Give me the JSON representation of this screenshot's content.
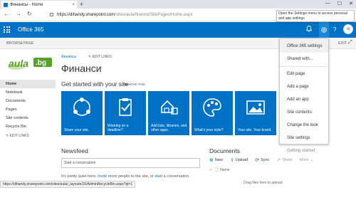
{
  "browser": {
    "tab_title": "Финансы - Home",
    "tab_close": "×",
    "new_tab": "+",
    "minimize": "—",
    "maximize": "☐",
    "close": "✕",
    "back": "←",
    "forward": "→",
    "refresh": "↻",
    "url_host": "https://dihandy.sharepoint.com",
    "url_path": "/sites/aula/finance/SitePages/Home.aspx",
    "tooltip": "Open the Settings menu to access personal and app settings"
  },
  "suitebar": {
    "brand": "Office 365",
    "bell_icon": "bell-icon",
    "gear_icon": "gear-icon",
    "help": "?",
    "color": "#0072c6"
  },
  "ribbon": {
    "browse": "BROWSE",
    "page": "PAGE",
    "edit": "EDIT"
  },
  "logo": {
    "text": "aula.bg"
  },
  "leftnav": {
    "items": [
      "Home",
      "Notebook",
      "Documents",
      "Pages",
      "Site contents",
      "Recycle Bin"
    ],
    "edit_links": "EDIT LINKS"
  },
  "header": {
    "breadcrumb": "Финансы",
    "edit_links": "EDIT LINKS",
    "title": "Финанси"
  },
  "getting_started": {
    "title": "Get started with your site",
    "remove": "REMOVE THIS",
    "tiles": [
      {
        "label": "Share your site.",
        "icon": "share-icon"
      },
      {
        "label": "Working on a deadline?",
        "icon": "checklist-icon"
      },
      {
        "label": "Add lists, libraries, and other apps.",
        "icon": "apps-icon"
      },
      {
        "label": "What's your style?",
        "icon": "palette-icon"
      },
      {
        "label": "Your site. Your brand.",
        "icon": "image-icon"
      }
    ]
  },
  "newsfeed": {
    "title": "Newsfeed",
    "placeholder": "Start a conversation",
    "note_prefix": "It's pretty quiet here. ",
    "note_invite": "Invite",
    "note_middle": " more people to the site, or ",
    "note_start": "start",
    "note_suffix": " a conversation."
  },
  "documents": {
    "title": "Documents",
    "new": "New",
    "upload": "Upload",
    "sync": "Sync",
    "share": "Share",
    "more": "More",
    "column_name": "Name",
    "drag_hint": "Drag files here to upload"
  },
  "settings_menu": {
    "items": [
      "Office 365 settings",
      "Shared with...",
      "Edit page",
      "Add a page",
      "Add an app",
      "Site contents",
      "Change the look",
      "Site settings",
      "Getting started"
    ]
  },
  "status": {
    "url": "https://dihandy.sharepoint.com/sites/aula/_layouts/15/AdminRecycleBin.aspx?ql=1"
  }
}
